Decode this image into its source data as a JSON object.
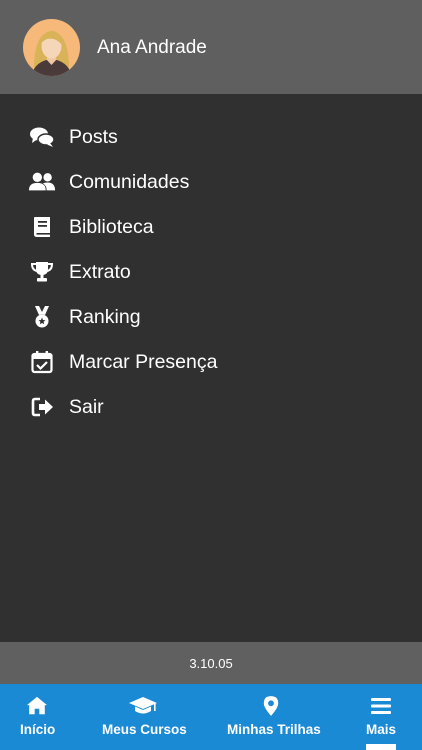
{
  "user": {
    "name": "Ana Andrade"
  },
  "menu": {
    "items": [
      {
        "label": "Posts",
        "icon": "comments-icon"
      },
      {
        "label": "Comunidades",
        "icon": "users-icon"
      },
      {
        "label": "Biblioteca",
        "icon": "book-icon"
      },
      {
        "label": "Extrato",
        "icon": "trophy-icon"
      },
      {
        "label": "Ranking",
        "icon": "medal-icon"
      },
      {
        "label": "Marcar Presença",
        "icon": "calendar-check-icon"
      },
      {
        "label": "Sair",
        "icon": "sign-out-icon"
      }
    ]
  },
  "footer": {
    "version": "3.10.05"
  },
  "tabbar": {
    "tabs": [
      {
        "label": "Início",
        "icon": "home-icon"
      },
      {
        "label": "Meus Cursos",
        "icon": "graduation-cap-icon"
      },
      {
        "label": "Minhas Trilhas",
        "icon": "map-pin-icon"
      },
      {
        "label": "Mais",
        "icon": "menu-icon",
        "active": true
      }
    ]
  },
  "colors": {
    "header": "#5f5f5f",
    "drawer": "#303030",
    "tabbar": "#1a8ad4",
    "text": "#ffffff"
  }
}
